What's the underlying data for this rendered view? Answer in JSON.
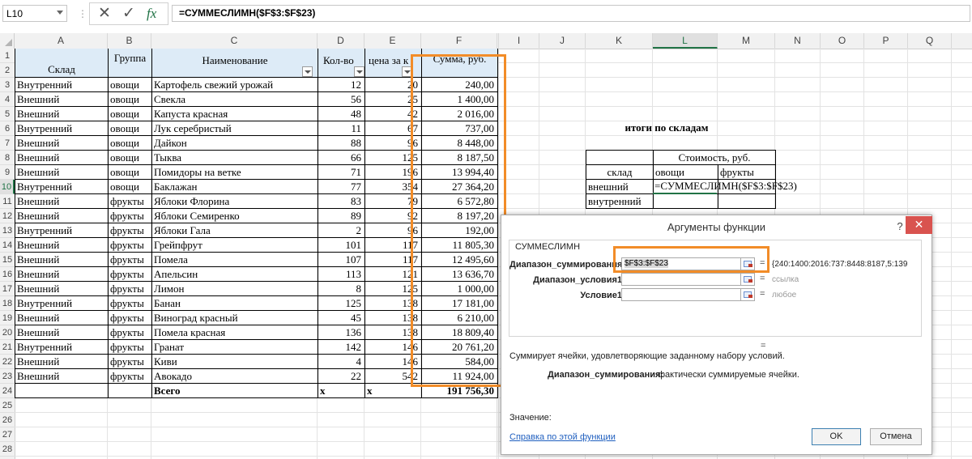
{
  "formula_bar": {
    "name_box": "L10",
    "separator": "⋮",
    "formula": "=СУММЕСЛИМН($F$3:$F$23)"
  },
  "columns": [
    "A",
    "B",
    "C",
    "D",
    "E",
    "F",
    "",
    "I",
    "J",
    "K",
    "L",
    "M",
    "N",
    "O",
    "P",
    "Q"
  ],
  "rows": [
    "1",
    "2",
    "3",
    "4",
    "5",
    "6",
    "7",
    "8",
    "9",
    "10",
    "11",
    "12",
    "13",
    "14",
    "15",
    "16",
    "17",
    "18",
    "19",
    "20",
    "21",
    "22",
    "23",
    "24",
    "25",
    "26",
    "27",
    "28"
  ],
  "table": {
    "headers": {
      "sklad": "Склад",
      "gruppa": "Группа",
      "name": "Наименование",
      "qty": "Кол-во",
      "price": "цена за к",
      "sum": "Сумма, руб."
    },
    "rows": [
      {
        "sklad": "Внутренний",
        "gruppa": "овощи",
        "name": "Картофель свежий урожай",
        "qty": "12",
        "price": "20",
        "sum": "240,00"
      },
      {
        "sklad": "Внешний",
        "gruppa": "овощи",
        "name": "Свекла",
        "qty": "56",
        "price": "25",
        "sum": "1 400,00"
      },
      {
        "sklad": "Внешний",
        "gruppa": "овощи",
        "name": "Капуста красная",
        "qty": "48",
        "price": "42",
        "sum": "2 016,00"
      },
      {
        "sklad": "Внутренний",
        "gruppa": "овощи",
        "name": "Лук серебристый",
        "qty": "11",
        "price": "67",
        "sum": "737,00"
      },
      {
        "sklad": "Внешний",
        "gruppa": "овощи",
        "name": "Дайкон",
        "qty": "88",
        "price": "96",
        "sum": "8 448,00"
      },
      {
        "sklad": "Внешний",
        "gruppa": "овощи",
        "name": "Тыква",
        "qty": "66",
        "price": "125",
        "sum": "8 187,50"
      },
      {
        "sklad": "Внешний",
        "gruppa": "овощи",
        "name": "Помидоры на ветке",
        "qty": "71",
        "price": "196",
        "sum": "13 994,40"
      },
      {
        "sklad": "Внутренний",
        "gruppa": "овощи",
        "name": "Баклажан",
        "qty": "77",
        "price": "354",
        "sum": "27 364,20"
      },
      {
        "sklad": "Внешний",
        "gruppa": "фрукты",
        "name": "Яблоки Флорина",
        "qty": "83",
        "price": "79",
        "sum": "6 572,80"
      },
      {
        "sklad": "Внешний",
        "gruppa": "фрукты",
        "name": "Яблоки Семиренко",
        "qty": "89",
        "price": "92",
        "sum": "8 197,20"
      },
      {
        "sklad": "Внутренний",
        "gruppa": "фрукты",
        "name": "Яблоки Гала",
        "qty": "2",
        "price": "96",
        "sum": "192,00"
      },
      {
        "sklad": "Внешний",
        "gruppa": "фрукты",
        "name": "Грейпфрут",
        "qty": "101",
        "price": "117",
        "sum": "11 805,30"
      },
      {
        "sklad": "Внешний",
        "gruppa": "фрукты",
        "name": "Помела",
        "qty": "107",
        "price": "117",
        "sum": "12 495,60"
      },
      {
        "sklad": "Внешний",
        "gruppa": "фрукты",
        "name": "Апельсин",
        "qty": "113",
        "price": "121",
        "sum": "13 636,70"
      },
      {
        "sklad": "Внешний",
        "gruppa": "фрукты",
        "name": "Лимон",
        "qty": "8",
        "price": "125",
        "sum": "1 000,00"
      },
      {
        "sklad": "Внутренний",
        "gruppa": "фрукты",
        "name": "Банан",
        "qty": "125",
        "price": "138",
        "sum": "17 181,00"
      },
      {
        "sklad": "Внешний",
        "gruppa": "фрукты",
        "name": "Виноград  красный",
        "qty": "45",
        "price": "138",
        "sum": "6 210,00"
      },
      {
        "sklad": "Внешний",
        "gruppa": "фрукты",
        "name": "Помела красная",
        "qty": "136",
        "price": "138",
        "sum": "18 809,40"
      },
      {
        "sklad": "Внутренний",
        "gruppa": "фрукты",
        "name": "Гранат",
        "qty": "142",
        "price": "146",
        "sum": "20 761,20"
      },
      {
        "sklad": "Внешний",
        "gruppa": "фрукты",
        "name": "Киви",
        "qty": "4",
        "price": "146",
        "sum": "584,00"
      },
      {
        "sklad": "Внешний",
        "gruppa": "фрукты",
        "name": "Авокадо",
        "qty": "22",
        "price": "542",
        "sum": "11 924,00"
      }
    ],
    "total": {
      "label": "Всего",
      "qty": "x",
      "price": "x",
      "sum": "191 756,30"
    }
  },
  "summary": {
    "title": "итоги по складам",
    "cost_header": "Стоимость, руб.",
    "col_sklad": "склад",
    "col_veg": "овощи",
    "col_fruit": "фрукты",
    "row_ext": "внешний",
    "row_int": "внутренний",
    "editing_formula": "=СУММЕСЛИМН($F$3:$F$23)"
  },
  "dialog": {
    "title": "Аргументы функции",
    "help": "?",
    "close": "✕",
    "function_name": "СУММЕСЛИМН",
    "arg1_label": "Диапазон_суммирования",
    "arg1_value": "$F$3:$F$23",
    "arg1_result": "{240:1400:2016:737:8448:8187,5:139",
    "arg2_label": "Диапазон_условия1",
    "arg2_hint": "ссылка",
    "arg3_label": "Условие1",
    "arg3_hint": "любое",
    "eq": "=",
    "description": "Суммирует ячейки, удовлетворяющие заданному набору условий.",
    "arg_desc_label": "Диапазон_суммирования:",
    "arg_desc_text": "фактически суммируемые ячейки.",
    "value_label": "Значение:",
    "help_link": "Справка по этой функции",
    "ok": "OK",
    "cancel": "Отмена"
  },
  "colors": {
    "accent": "#217346",
    "highlight": "#f28c28",
    "header_fill": "#ddebf7",
    "close": "#d9534f"
  }
}
